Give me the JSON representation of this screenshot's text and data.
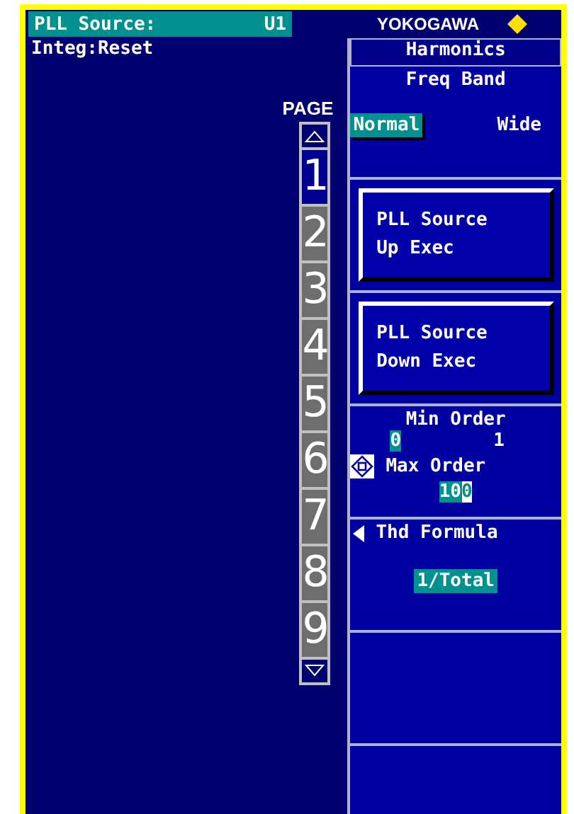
{
  "header": {
    "source_label": "PLL Source:",
    "source_value": "U1",
    "brand": "YOKOGAWA",
    "status": "Integ:Reset"
  },
  "pages": {
    "label": "PAGE",
    "items": [
      {
        "label": "1",
        "selected": true
      },
      {
        "label": "2",
        "selected": false
      },
      {
        "label": "3",
        "selected": false
      },
      {
        "label": "4",
        "selected": false
      },
      {
        "label": "5",
        "selected": false
      },
      {
        "label": "6",
        "selected": false
      },
      {
        "label": "7",
        "selected": false
      },
      {
        "label": "8",
        "selected": false
      },
      {
        "label": "9",
        "selected": false
      }
    ]
  },
  "menu": {
    "title": "Harmonics",
    "sections": [
      {
        "kind": "options",
        "label": "Freq Band",
        "options": [
          {
            "label": "Normal",
            "selected": true
          },
          {
            "label": "Wide",
            "selected": false
          }
        ]
      },
      {
        "kind": "button",
        "label": "PLL Source\nUp Exec"
      },
      {
        "kind": "button",
        "label": "PLL Source\nDown Exec"
      },
      {
        "kind": "orders",
        "min_label": "Min Order",
        "min_value": "0",
        "min_reading": "1",
        "max_label": "Max Order",
        "max_value": "10",
        "max_cursor": "0"
      },
      {
        "kind": "formula",
        "label": "Thd Formula",
        "value": "1/Total"
      },
      {
        "kind": "blank"
      },
      {
        "kind": "blank"
      }
    ]
  }
}
